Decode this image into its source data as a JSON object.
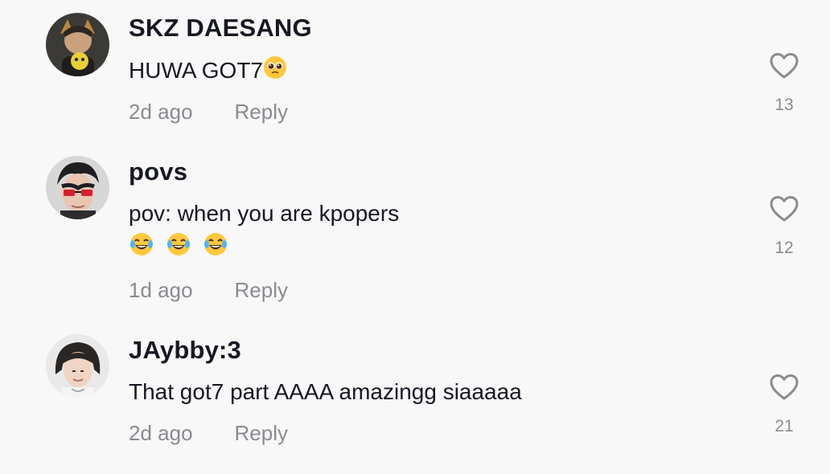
{
  "comments": [
    {
      "username": "SKZ DAESANG",
      "text": "HUWA GOT7",
      "emoji": "pleading-face",
      "time": "2d ago",
      "reply_label": "Reply",
      "like_count": "13"
    },
    {
      "username": "povs",
      "text": "pov: when you are kpopers",
      "emoji_line": [
        "tears-of-joy",
        "tears-of-joy",
        "tears-of-joy"
      ],
      "time": "1d ago",
      "reply_label": "Reply",
      "like_count": "12"
    },
    {
      "username": "JAybby:3",
      "text": "That got7 part AAAA amazingg siaaaaa",
      "time": "2d ago",
      "reply_label": "Reply",
      "like_count": "21"
    }
  ],
  "colors": {
    "background": "#f8f8f8",
    "text": "#161823",
    "muted": "#8a8b91"
  },
  "icons": [
    "heart-outline-icon"
  ]
}
